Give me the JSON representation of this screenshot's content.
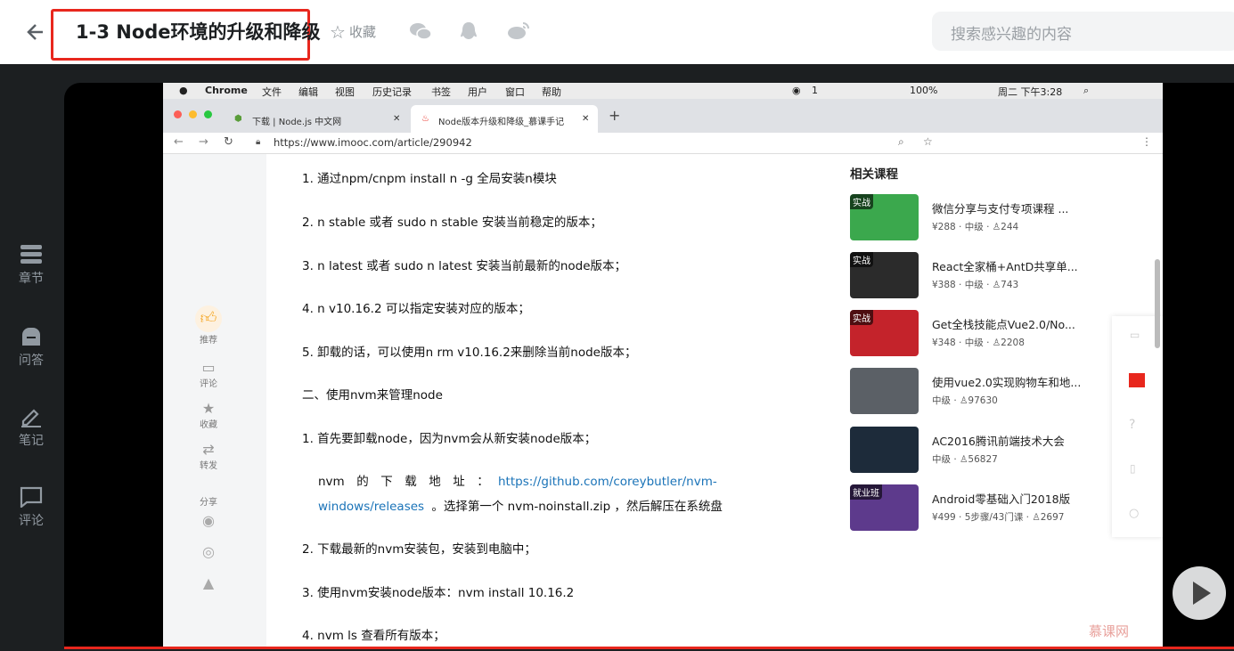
{
  "header": {
    "title": "1-3 Node环境的升级和降级",
    "favorite_label": "收藏",
    "search_placeholder": "搜索感兴趣的内容"
  },
  "left_nav": [
    {
      "label": "章节",
      "icon": "list-icon"
    },
    {
      "label": "问答",
      "icon": "chat-icon"
    },
    {
      "label": "笔记",
      "icon": "pen-icon"
    },
    {
      "label": "评论",
      "icon": "comment-icon"
    }
  ],
  "mac_menu": {
    "app": "Chrome",
    "items": [
      "文件",
      "编辑",
      "视图",
      "历史记录",
      "书签",
      "用户",
      "窗口",
      "帮助"
    ],
    "wechat_count": "1",
    "battery": "100%",
    "clock": "周二 下午3:28"
  },
  "browser": {
    "tabs": [
      {
        "title": "下载 | Node.js 中文网"
      },
      {
        "title": "Node版本升级和降级_慕课手记"
      }
    ],
    "url": "https://www.imooc.com/article/290942"
  },
  "article": {
    "lines": [
      "1. 通过npm/cnpm install n -g  全局安装n模块",
      "2. n stable 或者 sudo n stable 安装当前稳定的版本；",
      "3. n latest 或者 sudo n latest 安装当前最新的node版本；",
      "4. n v10.16.2 可以指定安装对应的版本；",
      "5. 卸载的话，可以使用n rm v10.16.2来删除当前node版本；",
      "二、使用nvm来管理node",
      "1. 首先要卸载node，因为nvm会从新安装node版本；"
    ],
    "download_prefix": "nvm　的　下　载　地　址　：",
    "link_part1": "https://github.com/coreybutler/nvm-",
    "link_part2": "windows/releases",
    "download_suffix": "。选择第一个 nvm-noinstall.zip ，然后解压在系统盘",
    "lines2": [
      "2. 下载最新的nvm安装包，安装到电脑中；",
      "3. 使用nvm安装node版本：nvm install 10.16.2",
      "4. nvm ls 查看所有版本；"
    ]
  },
  "article_actions": {
    "recommend": "推荐",
    "comment": "评论",
    "collect": "收藏",
    "repost": "转发",
    "share": "分享"
  },
  "related": {
    "heading": "相关课程",
    "courses": [
      {
        "tag": "实战",
        "name": "微信分享与支付专项课程 ...",
        "meta": "¥288 · 中级 · ♙244",
        "color": "#3ba84d"
      },
      {
        "tag": "实战",
        "name": "React全家桶+AntD共享单...",
        "meta": "¥388 · 中级 · ♙743",
        "color": "#2b2b2b"
      },
      {
        "tag": "实战",
        "name": "Get全栈技能点Vue2.0/No...",
        "meta": "¥348 · 中级 · ♙2208",
        "color": "#c4232b"
      },
      {
        "tag": "",
        "name": "使用vue2.0实现购物车和地...",
        "meta": "中级 · ♙97630",
        "color": "#5b6066"
      },
      {
        "tag": "",
        "name": "AC2016腾讯前端技术大会",
        "meta": "中级 · ♙56827",
        "color": "#1d2b3a"
      },
      {
        "tag": "就业班",
        "name": "Android零基础入门2018版",
        "meta": "¥499 · 5步骤/43门课 · ♙2697",
        "color": "#5d3a8c"
      }
    ]
  },
  "watermark": "慕课网"
}
